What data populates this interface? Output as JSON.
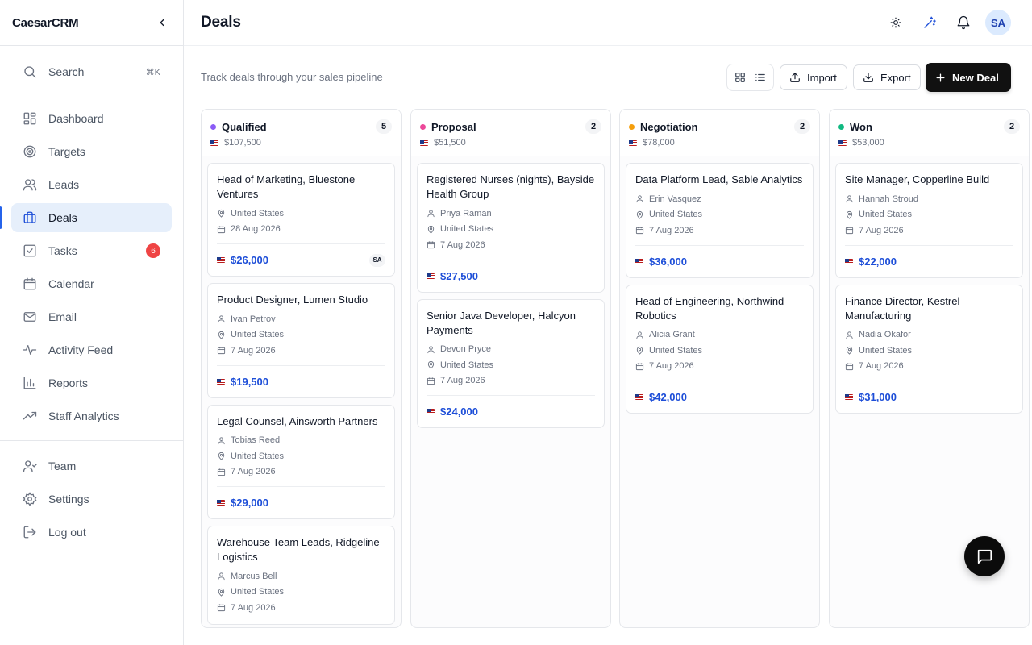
{
  "app": {
    "name": "CaesarCRM"
  },
  "sidebar": {
    "search": {
      "label": "Search",
      "shortcut": "⌘K"
    },
    "items": [
      {
        "label": "Dashboard",
        "icon": "dashboard-icon"
      },
      {
        "label": "Targets",
        "icon": "target-icon"
      },
      {
        "label": "Leads",
        "icon": "users-icon"
      },
      {
        "label": "Deals",
        "icon": "briefcase-icon",
        "active": true
      },
      {
        "label": "Tasks",
        "icon": "checkbox-icon",
        "badge": "6"
      },
      {
        "label": "Calendar",
        "icon": "calendar-icon"
      },
      {
        "label": "Email",
        "icon": "mail-icon"
      },
      {
        "label": "Activity Feed",
        "icon": "activity-icon"
      },
      {
        "label": "Reports",
        "icon": "bar-chart-icon"
      },
      {
        "label": "Staff Analytics",
        "icon": "trending-icon"
      }
    ],
    "bottom": [
      {
        "label": "Team",
        "icon": "team-icon"
      },
      {
        "label": "Settings",
        "icon": "gear-icon"
      },
      {
        "label": "Log out",
        "icon": "logout-icon"
      }
    ]
  },
  "header": {
    "title": "Deals",
    "avatar": "SA"
  },
  "toolbar": {
    "subtitle": "Track deals through your sales pipeline",
    "import_label": "Import",
    "export_label": "Export",
    "new_label": "New Deal"
  },
  "colors": {
    "qualified": "#8b5cf6",
    "proposal": "#ec4899",
    "negotiation": "#f59e0b",
    "won": "#10b981",
    "accent": "#1d4ed8"
  },
  "columns": [
    {
      "title": "Qualified",
      "count": "5",
      "total": "$107,500",
      "cards": [
        {
          "title": "Head of Marketing, Bluestone Ventures",
          "location": "United States",
          "date": "28 Aug 2026",
          "amount": "$26,000",
          "owner": "SA"
        },
        {
          "title": "Product Designer, Lumen Studio",
          "person": "Ivan Petrov",
          "location": "United States",
          "date": "7 Aug 2026",
          "amount": "$19,500"
        },
        {
          "title": "Legal Counsel, Ainsworth Partners",
          "person": "Tobias Reed",
          "location": "United States",
          "date": "7 Aug 2026",
          "amount": "$29,000"
        },
        {
          "title": "Warehouse Team Leads, Ridgeline Logistics",
          "person": "Marcus Bell",
          "location": "United States",
          "date": "7 Aug 2026"
        }
      ]
    },
    {
      "title": "Proposal",
      "count": "2",
      "total": "$51,500",
      "cards": [
        {
          "title": "Registered Nurses (nights), Bayside Health Group",
          "person": "Priya Raman",
          "location": "United States",
          "date": "7 Aug 2026",
          "amount": "$27,500"
        },
        {
          "title": "Senior Java Developer, Halcyon Payments",
          "person": "Devon Pryce",
          "location": "United States",
          "date": "7 Aug 2026",
          "amount": "$24,000"
        }
      ]
    },
    {
      "title": "Negotiation",
      "count": "2",
      "total": "$78,000",
      "cards": [
        {
          "title": "Data Platform Lead, Sable Analytics",
          "person": "Erin Vasquez",
          "location": "United States",
          "date": "7 Aug 2026",
          "amount": "$36,000"
        },
        {
          "title": "Head of Engineering, Northwind Robotics",
          "person": "Alicia Grant",
          "location": "United States",
          "date": "7 Aug 2026",
          "amount": "$42,000"
        }
      ]
    },
    {
      "title": "Won",
      "count": "2",
      "total": "$53,000",
      "cards": [
        {
          "title": "Site Manager, Copperline Build",
          "person": "Hannah Stroud",
          "location": "United States",
          "date": "7 Aug 2026",
          "amount": "$22,000"
        },
        {
          "title": "Finance Director, Kestrel Manufacturing",
          "person": "Nadia Okafor",
          "location": "United States",
          "date": "7 Aug 2026",
          "amount": "$31,000"
        }
      ]
    }
  ]
}
